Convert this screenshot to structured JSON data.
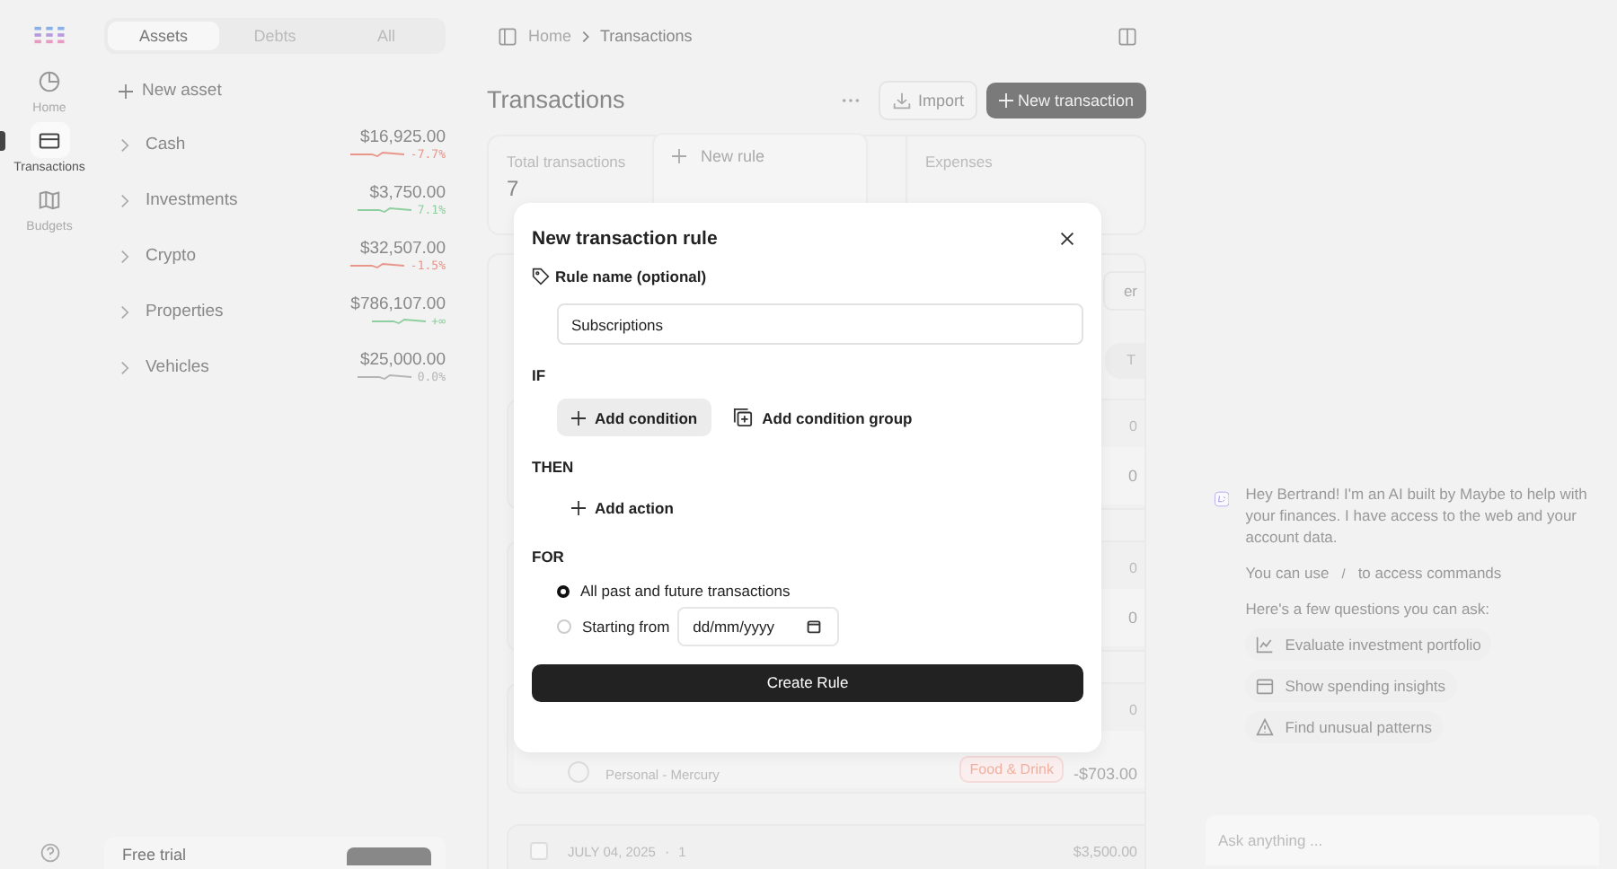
{
  "rail": {
    "items": [
      {
        "kind": "home",
        "label": "Home",
        "selected": false
      },
      {
        "kind": "card",
        "label": "Transactions",
        "selected": true
      },
      {
        "kind": "map",
        "label": "Budgets",
        "selected": false
      }
    ]
  },
  "sidebar": {
    "tabs": [
      {
        "label": "Assets",
        "selected": true
      },
      {
        "label": "Debts",
        "selected": false
      },
      {
        "label": "All",
        "selected": false
      }
    ],
    "new_button": "New asset",
    "accounts": [
      {
        "name": "Cash",
        "amount": "$16,925.00",
        "change": "-7.7%",
        "color": "#e8958a"
      },
      {
        "name": "Investments",
        "amount": "$3,750.00",
        "change": "7.1%",
        "color": "#8fcf9f"
      },
      {
        "name": "Crypto",
        "amount": "$32,507.00",
        "change": "-1.5%",
        "color": "#e8958a"
      },
      {
        "name": "Properties",
        "amount": "$786,107.00",
        "change": "+∞",
        "color": "#8fcf9f"
      },
      {
        "name": "Vehicles",
        "amount": "$25,000.00",
        "change": "0.0%",
        "color": "#b5b5b5"
      }
    ],
    "trial": {
      "label": "Free trial"
    }
  },
  "header": {
    "breadcrumb": [
      "Home",
      "Transactions"
    ]
  },
  "page": {
    "title": "Transactions",
    "import": "Import",
    "new_transaction": "New transaction"
  },
  "stats": [
    {
      "label": "Total transactions",
      "value": "7"
    },
    {
      "label": "Expenses"
    }
  ],
  "rule_menu": {
    "label": "New rule"
  },
  "list": {
    "filter_fragment": "er",
    "header_fragment": "T",
    "groups": [
      {
        "header_amount": "0",
        "rows": [
          {
            "amount": "0"
          }
        ]
      },
      {
        "header_amount": "0",
        "rows": [
          {
            "amount": "0"
          }
        ]
      },
      {
        "header_amount": "0",
        "rows": [
          {
            "account": "Personal - Mercury",
            "category": "Food & Drink",
            "amount": "-$703.00"
          }
        ]
      },
      {
        "checked": false,
        "date": "JULY 04, 2025",
        "separator": "·",
        "count": "1",
        "header_amount": "$3,500.00"
      }
    ]
  },
  "modal": {
    "title": "New transaction rule",
    "name_label": "Rule name (optional)",
    "name_value": "Subscriptions",
    "if_label": "IF",
    "add_condition": "Add condition",
    "add_condition_group": "Add condition group",
    "then_label": "THEN",
    "add_action": "Add action",
    "for_label": "FOR",
    "options": [
      {
        "kind": "all",
        "label": "All past and future transactions",
        "selected": true
      },
      {
        "kind": "date",
        "label": "Starting from",
        "placeholder": "dd/mm/yyyy",
        "selected": false
      }
    ],
    "submit": "Create Rule"
  },
  "chat": {
    "intro": "Hey Bertrand! I'm an AI built by Maybe to help with your finances. I have access to the web and your account data.",
    "commands": {
      "before": "You can use",
      "key": "/",
      "after": "to access commands"
    },
    "prompt": "Here's a few questions you can ask:",
    "suggestions": [
      {
        "kind": "chart",
        "label": "Evaluate investment portfolio"
      },
      {
        "kind": "wallet",
        "label": "Show spending insights"
      },
      {
        "kind": "warning",
        "label": "Find unusual patterns"
      }
    ],
    "input_placeholder": "Ask anything ..."
  }
}
